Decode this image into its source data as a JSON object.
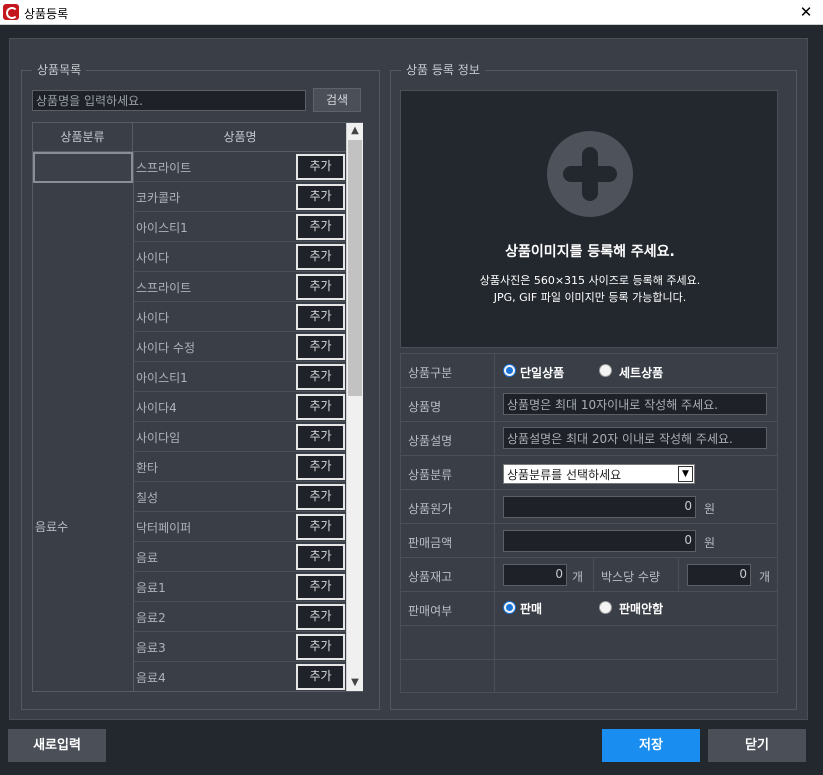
{
  "window": {
    "title": "상품등록",
    "close_glyph": "✕"
  },
  "left_panel": {
    "title": "상품목록",
    "search": {
      "placeholder": "상품명을 입력하세요.",
      "value": "상품명을 입력하세요.",
      "button": "검색"
    },
    "grid": {
      "headers": [
        "상품분류",
        "상품명"
      ],
      "category": "음료수",
      "add_label": "추가",
      "items": [
        "스프라이트",
        "코카콜라",
        "아이스티1",
        "사이다",
        "스프라이트",
        "사이다",
        "사이다 수정",
        "아이스티1",
        "사이다4",
        "사이다임",
        "환타",
        "칠성",
        "닥터페이퍼",
        "음료",
        "음료1",
        "음료2",
        "음료3",
        "음료4"
      ]
    },
    "scroll": {
      "up": "▲",
      "down": "▼"
    }
  },
  "right_panel": {
    "title": "상품 등록 정보",
    "image": {
      "main_text": "상품이미지를 등록해 주세요.",
      "sub_text1": "상품사진은 560×315 사이즈로 등록해 주세요.",
      "sub_text2": "JPG, GIF 파일 이미지만 등록 가능합니다."
    },
    "form": {
      "type_label": "상품구분",
      "type_options": [
        "단일상품",
        "세트상품"
      ],
      "type_selected": "단일상품",
      "name_label": "상품명",
      "name_placeholder": "상품명은 최대 10자이내로 작성해 주세요.",
      "desc_label": "상품설명",
      "desc_placeholder": "상품설명은 최대 20자 이내로 작성해 주세요.",
      "category_label": "상품분류",
      "category_value": "상품분류를 선택하세요",
      "category_arrow": "▼",
      "cost_label": "상품원가",
      "cost_value": "0",
      "cost_unit": "원",
      "price_label": "판매금액",
      "price_value": "0",
      "price_unit": "원",
      "stock_label": "상품재고",
      "stock_value": "0",
      "stock_unit": "개",
      "box_label": "박스당 수량",
      "box_value": "0",
      "box_unit": "개",
      "sale_label": "판매여부",
      "sale_options": [
        "판매",
        "판매안함"
      ],
      "sale_selected": "판매"
    }
  },
  "footer": {
    "new_button": "새로입력",
    "save_button": "저장",
    "close_button": "닫기"
  },
  "colors": {
    "accent": "#1a8ef0",
    "background": "#3a3f47",
    "dark": "#23272e"
  }
}
